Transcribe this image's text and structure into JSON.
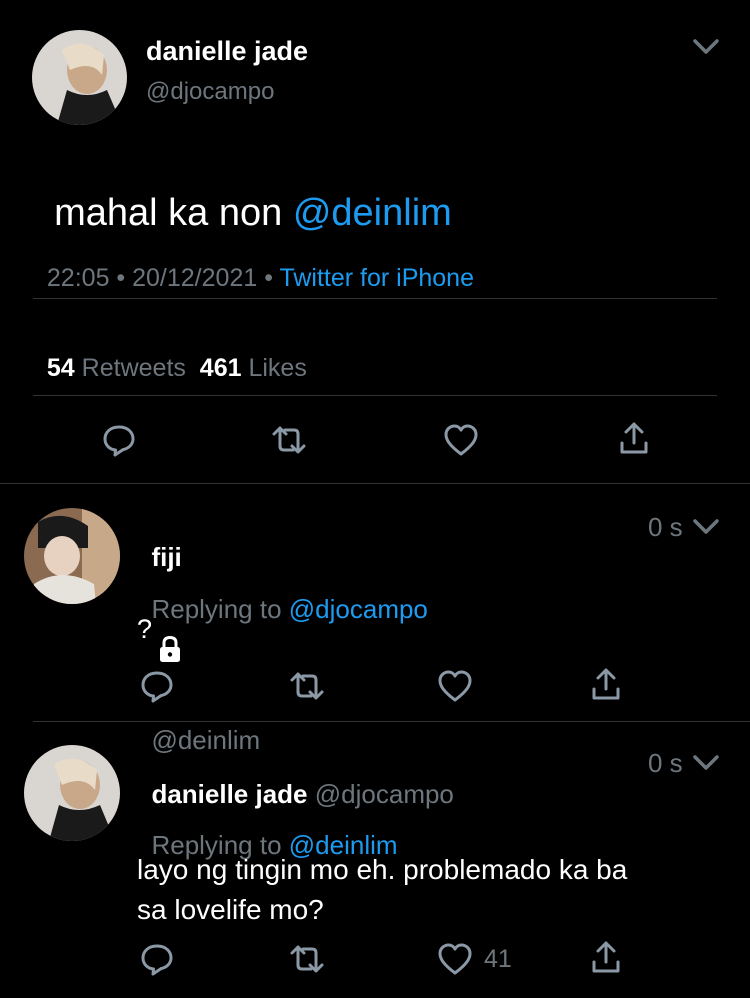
{
  "main_tweet": {
    "author_name": "danielle jade",
    "author_handle": "@djocampo",
    "text_plain": "mahal ka non ",
    "text_mention": "@deinlim",
    "time": "22:05",
    "date": "20/12/2021",
    "source": "Twitter for iPhone",
    "retweet_count": "54",
    "retweet_label": "Retweets",
    "like_count": "461",
    "like_label": "Likes"
  },
  "replies": [
    {
      "author_name": "fiji",
      "author_handle": "@deinlim",
      "time": "0 s",
      "replying_prefix": "Replying to",
      "replying_to": "@djocampo",
      "text": "?",
      "like_count": ""
    },
    {
      "author_name": "danielle jade",
      "author_handle": "@djocampo",
      "time": "0 s",
      "replying_prefix": "Replying to",
      "replying_to": "@deinlim",
      "text_line1": "layo ng tingin mo eh. problemado ka ba",
      "text_line2": "sa lovelife mo?",
      "like_count": "41"
    }
  ],
  "colors": {
    "accent": "#1d9bf0",
    "muted": "#6e767d",
    "background": "#000000",
    "divider": "#2f3336"
  },
  "icons": [
    "chevron-down-icon",
    "reply-icon",
    "retweet-icon",
    "like-icon",
    "share-icon",
    "lock-icon"
  ]
}
